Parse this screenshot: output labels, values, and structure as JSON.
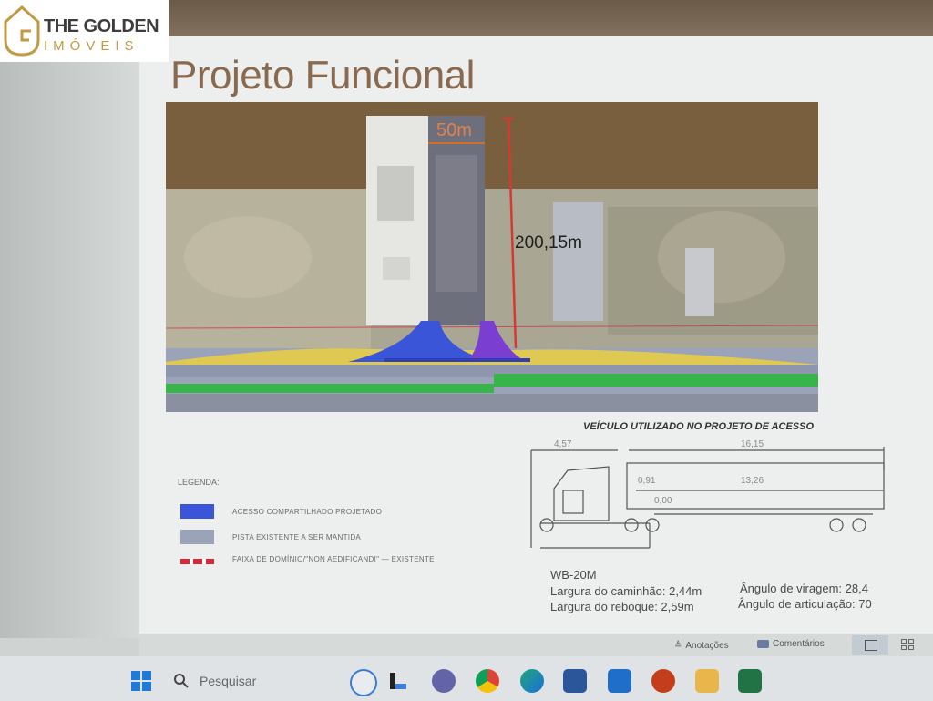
{
  "branding": {
    "line1": "THE GOLDEN",
    "line2": "IMÓVEIS",
    "gold": "#c09a45"
  },
  "slide": {
    "title": "Projeto Funcional"
  },
  "plan": {
    "width_label": "50m",
    "depth_label": "200,15m"
  },
  "legend": {
    "title": "LEGENDA:",
    "items": [
      {
        "label": "ACESSO COMPARTILHADO PROJETADO",
        "color": "#3b55d9"
      },
      {
        "label": "PISTA EXISTENTE A SER MANTIDA",
        "color": "#9aa3b8"
      },
      {
        "label": "FAIXA DE DOMÍNIO/\"NON AEDIFICANDI\" — EXISTENTE",
        "color": "#d8283a"
      }
    ]
  },
  "vehicle": {
    "title": "VEÍCULO UTILIZADO NO PROJETO DE ACESSO",
    "dims": [
      "4,57",
      "16,15",
      "0,91",
      "13,26",
      "0,00"
    ],
    "model": "WB-20M",
    "specs": [
      "Largura do caminhão: 2,44m",
      "Ângulo de viragem: 28,4",
      "Largura do reboque: 2,59m",
      "Ângulo de articulação: 70"
    ]
  },
  "ribbon": {
    "notes": "Anotações",
    "comments": "Comentários"
  },
  "taskbar": {
    "search_placeholder": "Pesquisar",
    "icons": [
      "windows-start",
      "search",
      "bing",
      "widgets",
      "teams-chat",
      "chrome",
      "edge",
      "word",
      "mail",
      "powerpoint",
      "file-explorer",
      "excel"
    ]
  }
}
